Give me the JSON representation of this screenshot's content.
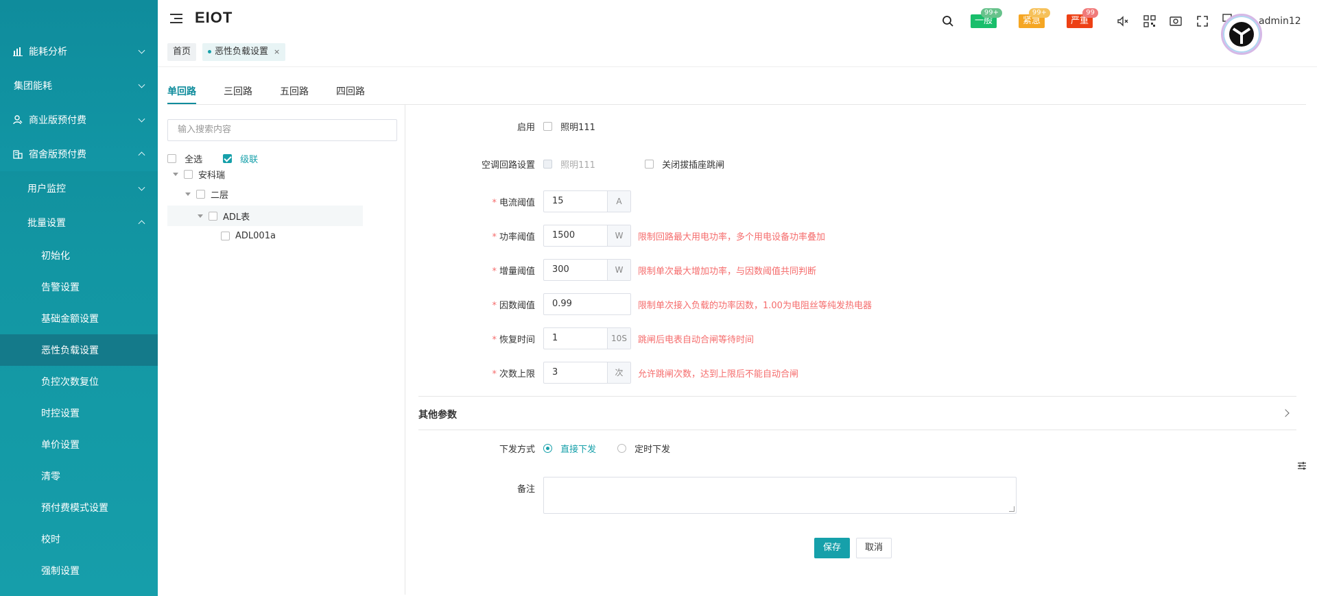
{
  "sidebar": {
    "menu": [
      {
        "label": "能耗分析",
        "icon": "bar-chart-icon"
      },
      {
        "label": "集团能耗",
        "icon": ""
      },
      {
        "label": "商业版预付费",
        "icon": "user-icon"
      },
      {
        "label": "宿舍版预付费",
        "icon": "building-icon"
      }
    ],
    "sub1": [
      {
        "label": "用户监控"
      },
      {
        "label": "批量设置"
      }
    ],
    "sub2": [
      {
        "label": "初始化"
      },
      {
        "label": "告警设置"
      },
      {
        "label": "基础金额设置"
      },
      {
        "label": "恶性负载设置"
      },
      {
        "label": "负控次数复位"
      },
      {
        "label": "时控设置"
      },
      {
        "label": "单价设置"
      },
      {
        "label": "清零"
      },
      {
        "label": "预付费模式设置"
      },
      {
        "label": "校时"
      },
      {
        "label": "强制设置"
      }
    ]
  },
  "header": {
    "brand": "EIOT",
    "alarms": [
      {
        "label": "一般",
        "badge": "99+",
        "color": "#19be6b",
        "badge_color": "#67c28b"
      },
      {
        "label": "紧急",
        "badge": "99+",
        "color": "#f5a623",
        "badge_color": "#f6c15a"
      },
      {
        "label": "严重",
        "badge": "99",
        "color": "#ed4014",
        "badge_color": "#f07a7a"
      }
    ],
    "username": "admin12"
  },
  "page_tabs": {
    "home": "首页",
    "current": "恶性负载设置",
    "close": "×"
  },
  "loop_tabs": [
    "单回路",
    "三回路",
    "五回路",
    "四回路"
  ],
  "tree": {
    "search_placeholder": "输入搜索内容",
    "select_all": "全选",
    "cascade": "级联",
    "nodes": [
      "安科瑞",
      "二层",
      "ADL表",
      "ADL001a"
    ]
  },
  "form": {
    "enable_label": "启用",
    "enable_value": "照明111",
    "ac_label": "空调回路设置",
    "ac_value": "照明111",
    "socket_label": "关闭拔插座跳闸",
    "required_mark": "*",
    "fields": [
      {
        "label": "电流阈值",
        "value": "15",
        "unit": "A",
        "hint": ""
      },
      {
        "label": "功率阈值",
        "value": "1500",
        "unit": "W",
        "hint": "限制回路最大用电功率，多个用电设备功率叠加"
      },
      {
        "label": "增量阈值",
        "value": "300",
        "unit": "W",
        "hint": "限制单次最大增加功率，与因数阈值共同判断"
      },
      {
        "label": "因数阈值",
        "value": "0.99",
        "unit": "",
        "hint": "限制单次接入负载的功率因数，1.00为电阻丝等纯发热电器"
      },
      {
        "label": "恢复时间",
        "value": "1",
        "unit": "10S",
        "hint": "跳闸后电表自动合闸等待时间"
      },
      {
        "label": "次数上限",
        "value": "3",
        "unit": "次",
        "hint": "允许跳闸次数，达到上限后不能自动合闸"
      }
    ],
    "other_params": "其他参数",
    "send_label": "下发方式",
    "send_direct": "直接下发",
    "send_timed": "定时下发",
    "remark_label": "备注",
    "save": "保存",
    "cancel": "取消"
  }
}
